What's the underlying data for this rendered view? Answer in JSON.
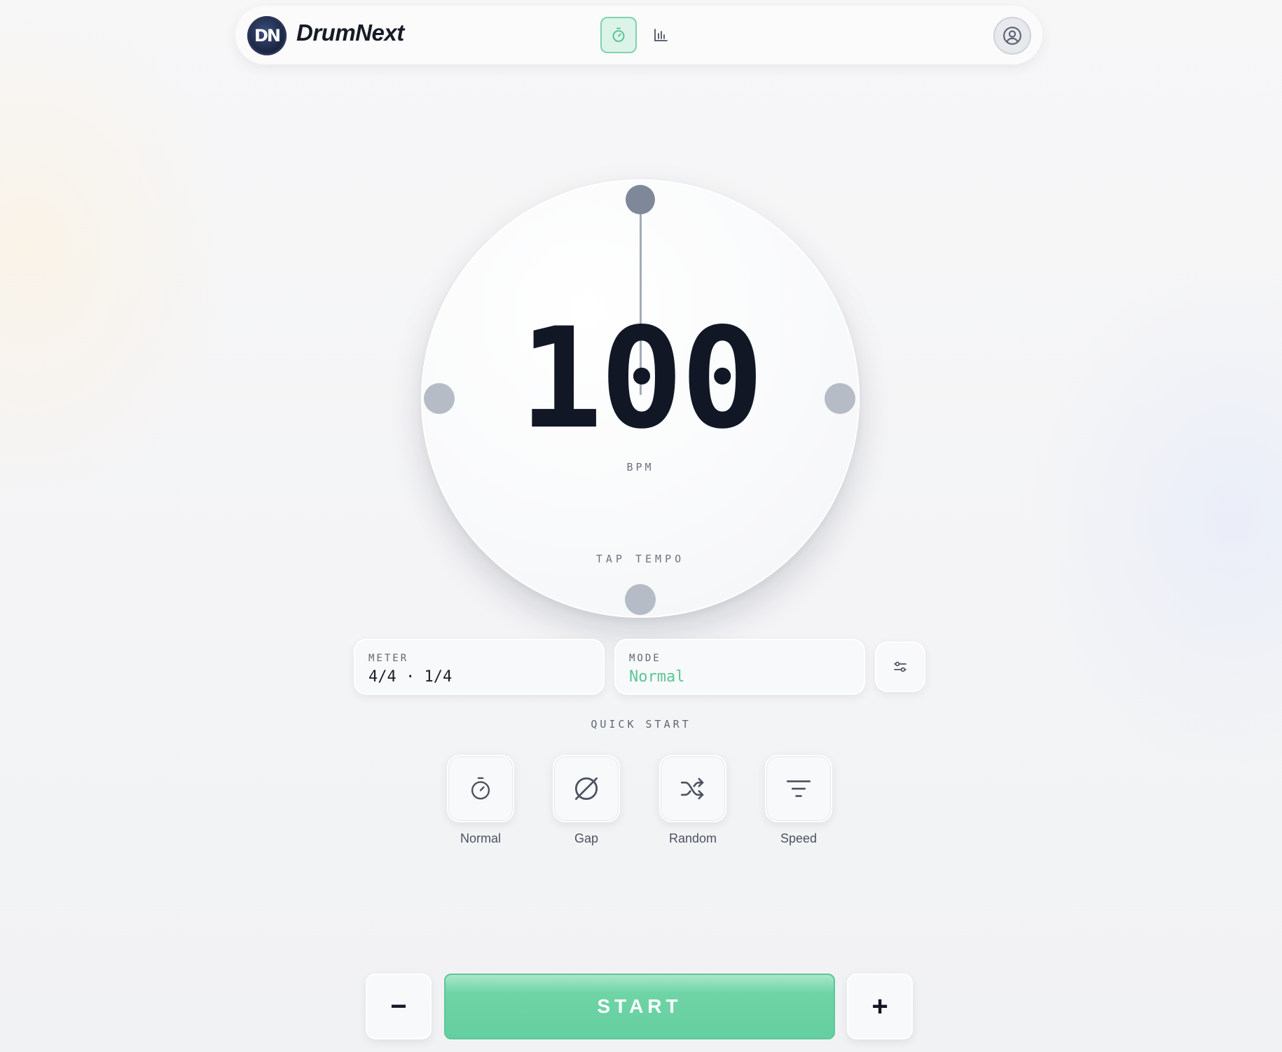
{
  "app": {
    "brand": "DrumNext",
    "logo_text": "DN"
  },
  "nav": {
    "items": [
      {
        "id": "metronome",
        "icon": "stopwatch-icon",
        "active": true
      },
      {
        "id": "stats",
        "icon": "bar-chart-icon",
        "active": false
      }
    ],
    "account_icon": "user-circle-icon"
  },
  "dial": {
    "bpm": "100",
    "bpm_label": "BPM",
    "tap_label": "TAP TEMPO"
  },
  "settings": {
    "meter_label": "METER",
    "meter_value": "4/4 · 1/4",
    "mode_label": "MODE",
    "mode_value": "Normal",
    "settings_icon": "sliders-icon"
  },
  "quick_start": {
    "title": "QUICK START",
    "items": [
      {
        "label": "Normal",
        "icon": "stopwatch-icon"
      },
      {
        "label": "Gap",
        "icon": "empty-set-icon"
      },
      {
        "label": "Random",
        "icon": "shuffle-icon"
      },
      {
        "label": "Speed",
        "icon": "filter-lines-icon"
      }
    ]
  },
  "controls": {
    "minus_label": "−",
    "start_label": "START",
    "plus_label": "+"
  },
  "colors": {
    "accent": "#64cf9f",
    "mode_text": "#5cc696",
    "text_dark": "#121726"
  }
}
